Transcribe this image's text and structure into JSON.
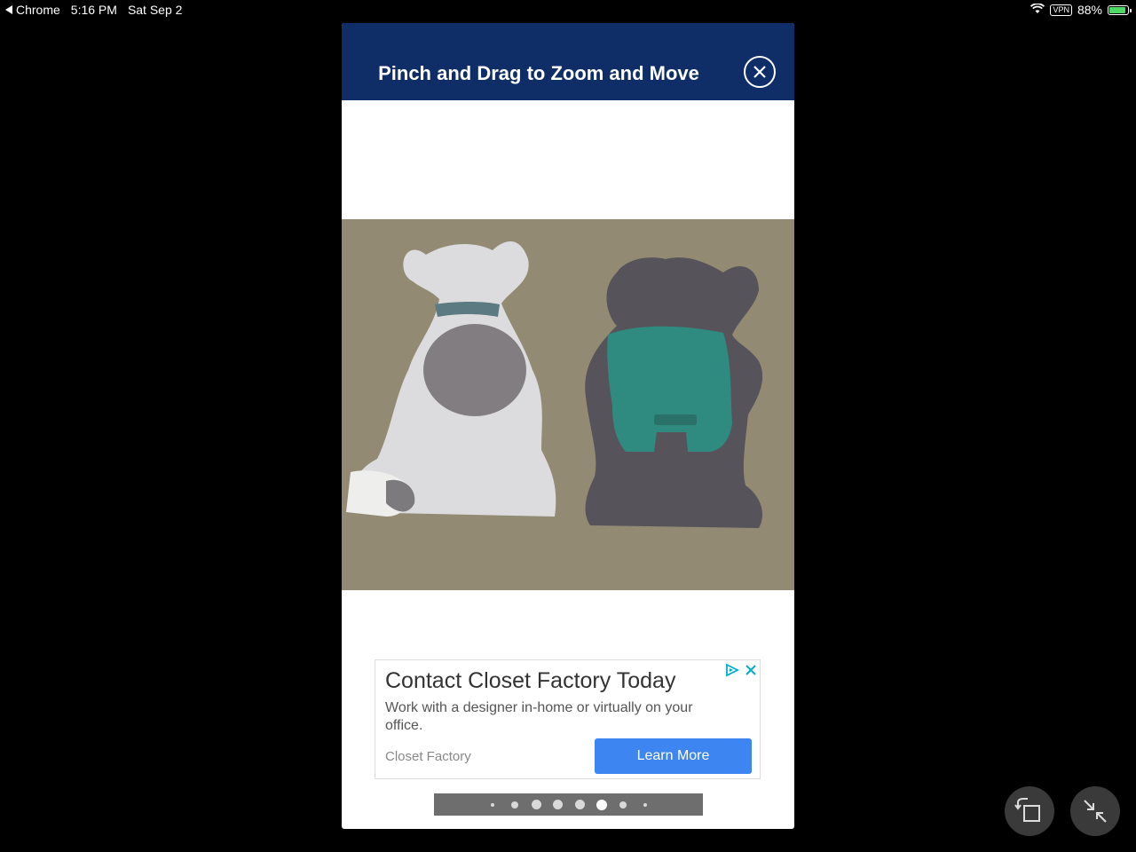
{
  "status_bar": {
    "app": "Chrome",
    "time": "5:16 PM",
    "date": "Sat Sep 2",
    "vpn": "VPN",
    "battery": "88%",
    "battery_level": 0.88
  },
  "viewer": {
    "title": "Pinch and Drag to Zoom and Move",
    "close_icon": "close-circle-icon"
  },
  "ad": {
    "title": "Contact Closet Factory Today",
    "description": "Work with a designer in-home or virtually on your office.",
    "source": "Closet Factory",
    "cta": "Learn More",
    "icons": [
      "adchoices-icon",
      "close-icon"
    ]
  },
  "pagination": {
    "total": 8,
    "active_index": 5
  },
  "controls": {
    "icons": [
      "rotate-icon",
      "minimize-icon"
    ]
  },
  "colors": {
    "header": "#0f2d67",
    "cta": "#3d85f0",
    "ad_icon": "#00aecd"
  }
}
